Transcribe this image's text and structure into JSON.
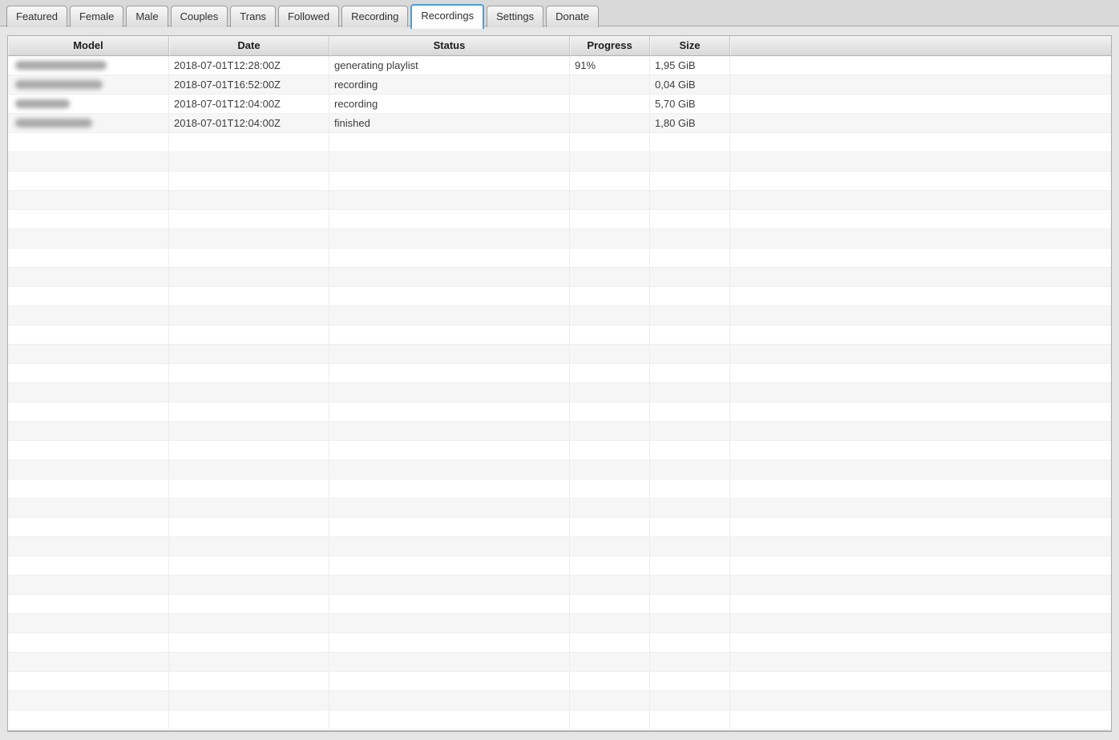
{
  "tab_bar": {
    "tabs": [
      {
        "label": "Featured"
      },
      {
        "label": "Female"
      },
      {
        "label": "Male"
      },
      {
        "label": "Couples"
      },
      {
        "label": "Trans"
      },
      {
        "label": "Followed"
      },
      {
        "label": "Recording"
      },
      {
        "label": "Recordings"
      },
      {
        "label": "Settings"
      },
      {
        "label": "Donate"
      }
    ],
    "active_tab": "Recordings"
  },
  "table": {
    "columns": [
      {
        "label": "Model"
      },
      {
        "label": "Date"
      },
      {
        "label": "Status"
      },
      {
        "label": "Progress"
      },
      {
        "label": "Size"
      },
      {
        "label": ""
      }
    ],
    "rows": [
      {
        "model_redacted": true,
        "model_blur_width": 114,
        "date": "2018-07-01T12:28:00Z",
        "status": "generating playlist",
        "progress": "91%",
        "size": "1,95 GiB"
      },
      {
        "model_redacted": true,
        "model_blur_width": 109,
        "date": "2018-07-01T16:52:00Z",
        "status": "recording",
        "progress": "",
        "size": "0,04 GiB"
      },
      {
        "model_redacted": true,
        "model_blur_width": 68,
        "date": "2018-07-01T12:04:00Z",
        "status": "recording",
        "progress": "",
        "size": "5,70 GiB"
      },
      {
        "model_redacted": true,
        "model_blur_width": 96,
        "date": "2018-07-01T12:04:00Z",
        "status": "finished",
        "progress": "",
        "size": "1,80 GiB"
      }
    ],
    "empty_row_count": 31
  },
  "colors": {
    "active_tab_border": "#4aa0d5",
    "stripe_row": "#f6f6f6",
    "window_bg": "#e6e6e6",
    "header_gradient_top": "#f3f3f3",
    "header_gradient_bottom": "#d8d8d8"
  }
}
